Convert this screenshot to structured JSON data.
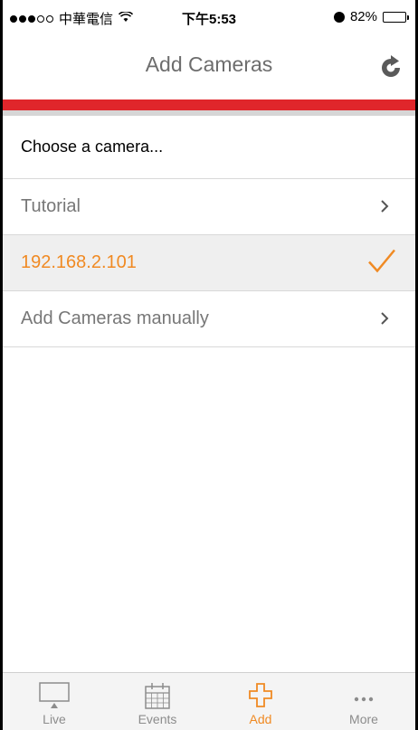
{
  "status_bar": {
    "carrier": "中華電信",
    "time": "下午5:53",
    "battery": "82%",
    "battery_level": 0.82
  },
  "nav": {
    "title": "Add Cameras"
  },
  "list": {
    "header": "Choose a camera...",
    "items": [
      {
        "label": "Tutorial",
        "accessory": "chevron"
      },
      {
        "label": "192.168.2.101",
        "accessory": "checkmark",
        "selected": true
      },
      {
        "label": "Add Cameras manually",
        "accessory": "chevron"
      }
    ]
  },
  "tabbar": {
    "tabs": [
      {
        "label": "Live",
        "icon": "monitor-icon"
      },
      {
        "label": "Events",
        "icon": "calendar-icon"
      },
      {
        "label": "Add",
        "icon": "plus-icon",
        "active": true
      },
      {
        "label": "More",
        "icon": "more-dots-icon"
      }
    ]
  },
  "colors": {
    "accent": "#f08a23",
    "red_bar": "#e0262b"
  }
}
